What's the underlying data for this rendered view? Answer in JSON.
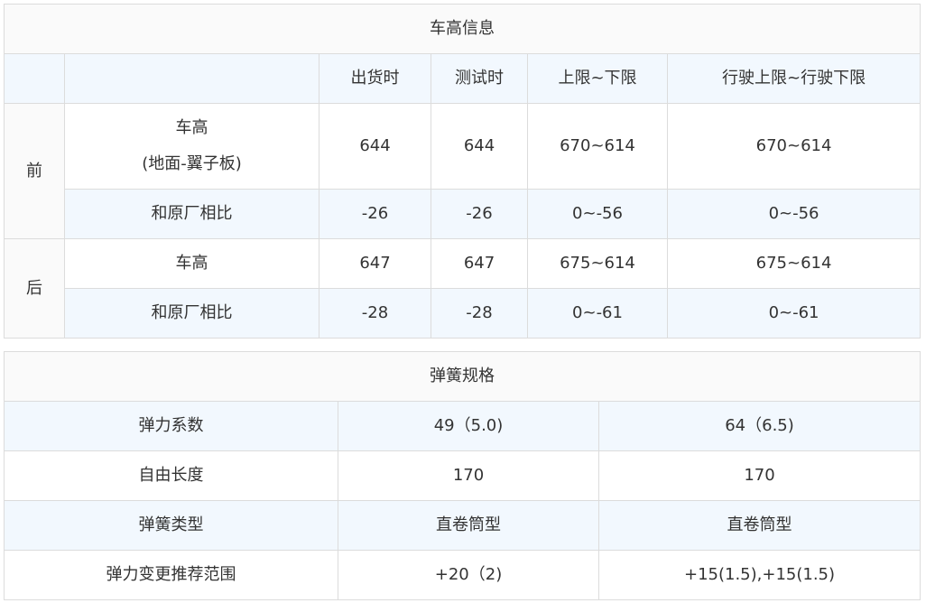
{
  "ride_height_table": {
    "title": "车高信息",
    "headers": [
      "出货时",
      "测试时",
      "上限~下限",
      "行驶上限~行驶下限"
    ],
    "front_label": "前",
    "rear_label": "后",
    "front_height_label_line1": "车高",
    "front_height_label_line2": "(地面-翼子板)",
    "rear_height_label": "车高",
    "compare_label": "和原厂相比",
    "front_height": [
      "644",
      "644",
      "670~614",
      "670~614"
    ],
    "front_compare": [
      "-26",
      "-26",
      "0~-56",
      "0~-56"
    ],
    "rear_height": [
      "647",
      "647",
      "675~614",
      "675~614"
    ],
    "rear_compare": [
      "-28",
      "-28",
      "0~-61",
      "0~-61"
    ]
  },
  "spring_table": {
    "title": "弹簧规格",
    "rows": [
      {
        "label": "弹力系数",
        "front": "49（5.0)",
        "rear": "64（6.5)"
      },
      {
        "label": "自由长度",
        "front": "170",
        "rear": "170"
      },
      {
        "label": "弹簧类型",
        "front": "直卷筒型",
        "rear": "直卷筒型"
      },
      {
        "label": "弹力变更推荐范围",
        "front": "+20（2)",
        "rear": "+15(1.5),+15(1.5)"
      }
    ]
  }
}
